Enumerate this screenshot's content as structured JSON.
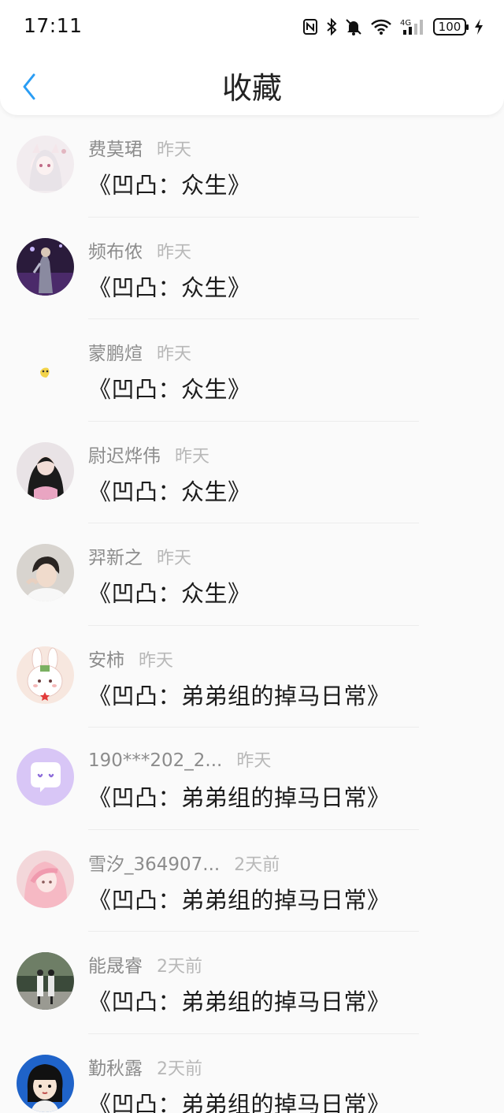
{
  "status_bar": {
    "time": "17:11",
    "battery": "100"
  },
  "header": {
    "title": "收藏"
  },
  "items": [
    {
      "name": "费莫珺",
      "time": "昨天",
      "work": "《凹凸：众生》",
      "avatar": "anime-girl"
    },
    {
      "name": "频布侬",
      "time": "昨天",
      "work": "《凹凸：众生》",
      "avatar": "stage-performer"
    },
    {
      "name": "蒙鹏煊",
      "time": "昨天",
      "work": "《凹凸：众生》",
      "avatar": "blank-sticker"
    },
    {
      "name": "尉迟烨伟",
      "time": "昨天",
      "work": "《凹凸：众生》",
      "avatar": "girl-dark-hair"
    },
    {
      "name": "羿新之",
      "time": "昨天",
      "work": "《凹凸：众生》",
      "avatar": "boy-portrait"
    },
    {
      "name": "安柿",
      "time": "昨天",
      "work": "《凹凸：弟弟组的掉马日常》",
      "avatar": "bunny-cartoon"
    },
    {
      "name": "190***202_2...",
      "time": "昨天",
      "work": "《凹凸：弟弟组的掉马日常》",
      "avatar": "default-chat"
    },
    {
      "name": "雪汐_364907...",
      "time": "2天前",
      "work": "《凹凸：弟弟组的掉马日常》",
      "avatar": "pink-girl"
    },
    {
      "name": "能晟睿",
      "time": "2天前",
      "work": "《凹凸：弟弟组的掉马日常》",
      "avatar": "couple-street"
    },
    {
      "name": "勤秋露",
      "time": "2天前",
      "work": "《凹凸：弟弟组的掉马日常》",
      "avatar": "cartoon-girl-blue"
    }
  ],
  "colors": {
    "accent": "#2a9df4",
    "name": "#8c8c8c",
    "time": "#b8b8b8"
  }
}
